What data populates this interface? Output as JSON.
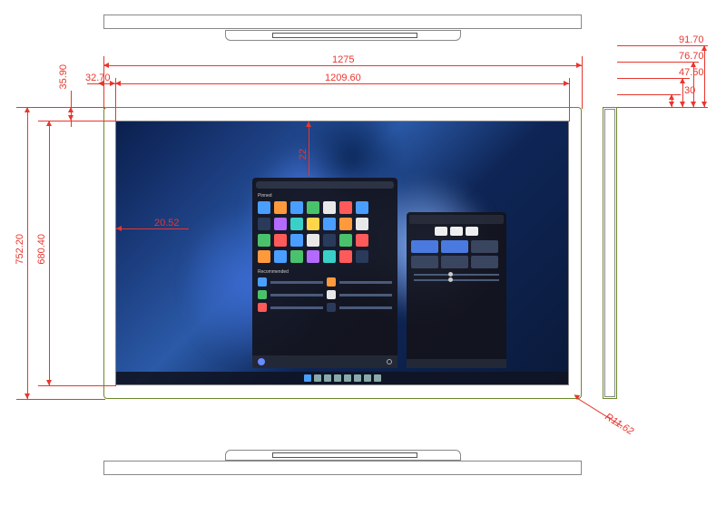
{
  "dimensions": {
    "total_width": "1275",
    "screen_width": "1209.60",
    "total_height": "752.20",
    "screen_height": "680.40",
    "top_bezel": "35.90",
    "left_bezel": "32.70",
    "inner_left": "20.52",
    "inner_top_partial": "22",
    "side_d1": "91.70",
    "side_d2": "76.70",
    "side_d3": "47.50",
    "side_d4": "30",
    "corner_radius": "R11.62"
  },
  "views": {
    "top": "top-profile",
    "bottom": "bottom-profile",
    "side": "side-profile",
    "front": "front-view"
  },
  "colors": {
    "dim": "#e8362e",
    "outline": "#888888",
    "outline_alt": "#6a8a2a"
  }
}
